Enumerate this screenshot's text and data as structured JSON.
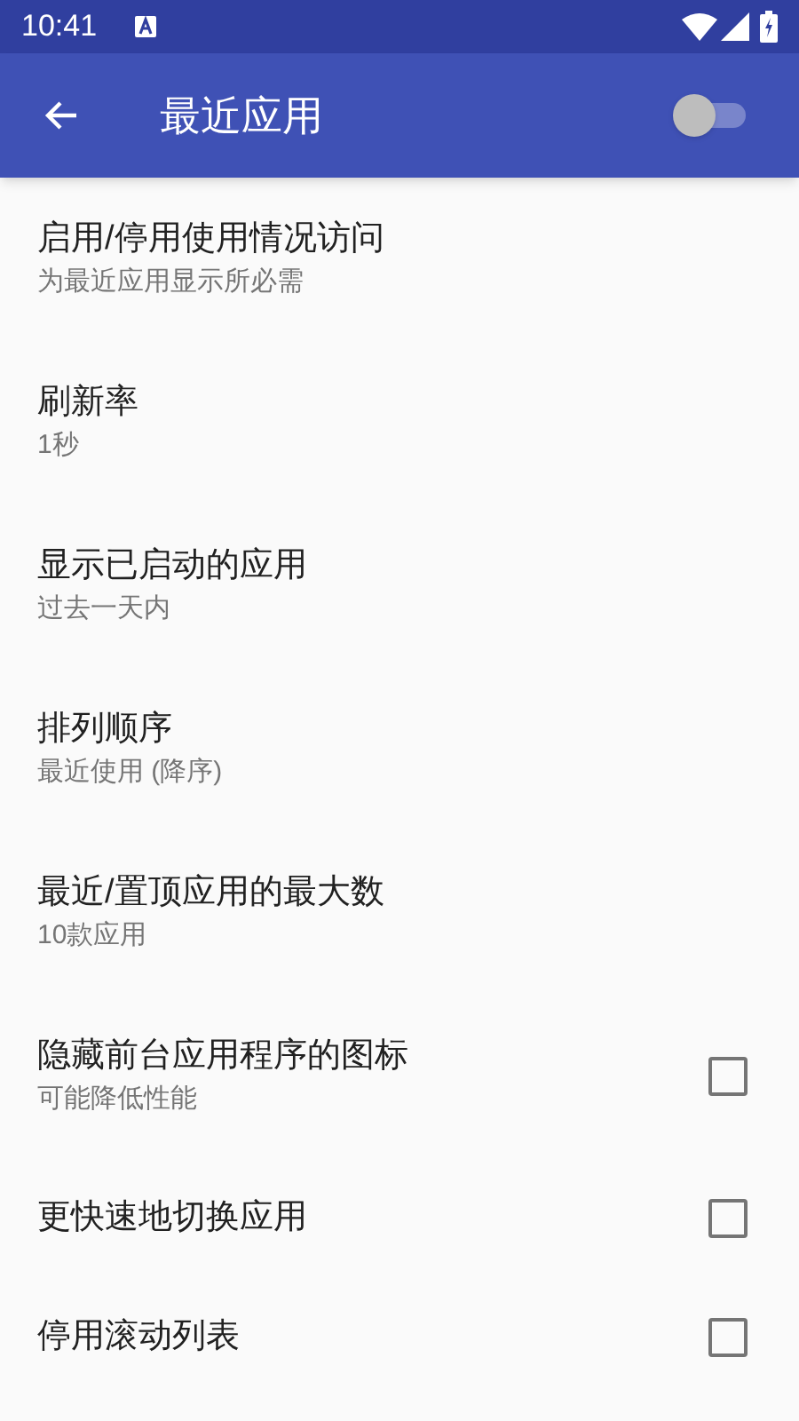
{
  "status_bar": {
    "time": "10:41"
  },
  "app_bar": {
    "title": "最近应用",
    "switch": {
      "on": false
    }
  },
  "settings": [
    {
      "kind": "setting",
      "title": "启用/停用使用情况访问",
      "summary": "为最近应用显示所必需"
    },
    {
      "kind": "setting",
      "title": "刷新率",
      "summary": "1秒"
    },
    {
      "kind": "setting",
      "title": "显示已启动的应用",
      "summary": "过去一天内"
    },
    {
      "kind": "setting",
      "title": "排列顺序",
      "summary": "最近使用 (降序)"
    },
    {
      "kind": "setting",
      "title": "最近/置顶应用的最大数",
      "summary": "10款应用"
    },
    {
      "kind": "checkbox",
      "title": "隐藏前台应用程序的图标",
      "summary": "可能降低性能",
      "checked": false
    },
    {
      "kind": "checkbox",
      "title": "更快速地切换应用",
      "checked": false
    },
    {
      "kind": "checkbox",
      "title": "停用滚动列表",
      "checked": false
    }
  ]
}
